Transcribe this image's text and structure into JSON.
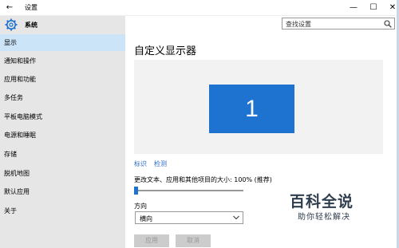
{
  "window": {
    "back_glyph": "←",
    "title": "设置",
    "minimize_glyph": "—",
    "maximize_glyph": "☐",
    "close_glyph": "✕"
  },
  "sidebar": {
    "header": "系统",
    "items": [
      {
        "label": "显示",
        "active": true
      },
      {
        "label": "通知和操作"
      },
      {
        "label": "应用和功能"
      },
      {
        "label": "多任务"
      },
      {
        "label": "平板电脑模式"
      },
      {
        "label": "电源和睡眠"
      },
      {
        "label": "存储"
      },
      {
        "label": "脱机地图"
      },
      {
        "label": "默认应用"
      },
      {
        "label": "关于"
      }
    ]
  },
  "search": {
    "placeholder": "查找设置"
  },
  "main": {
    "title": "自定义显示器",
    "monitor_number": "1",
    "links": {
      "identify": "标识",
      "detect": "检测"
    },
    "scale_label": "更改文本、应用和其他项目的大小: 100% (推荐)",
    "scale_value_percent": 100,
    "orientation_label": "方向",
    "orientation_value": "横向",
    "apply_label": "应用",
    "cancel_label": "取消"
  },
  "watermark": {
    "main": "百科全说",
    "sub": "助你轻松解决"
  },
  "colors": {
    "sidebar_bg": "#e6e6e6",
    "active_item_bg": "#cce4f7",
    "accent": "#1e73d1",
    "link": "#2b6cc4",
    "display_area_bg": "#f2f2f2"
  }
}
